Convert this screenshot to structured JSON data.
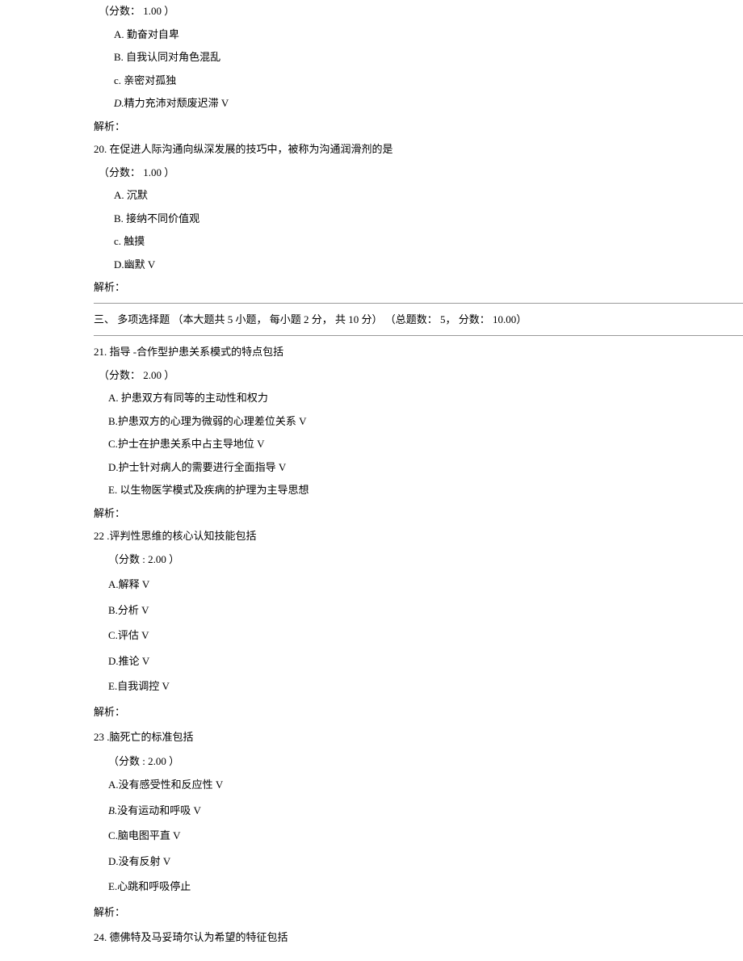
{
  "q19_tail": {
    "score": "（分数：  1.00 ）",
    "opts": {
      "a": "A.  勤奋对自卑",
      "b": "B.  自我认同对角色混乱",
      "c": "c. 亲密对孤独",
      "d_label": "D.",
      "d_text": "精力充沛对颓废迟滞 V"
    },
    "analysis": "解析："
  },
  "q20": {
    "stem": "20.  在促进人际沟通向纵深发展的技巧中，被称为沟通润滑剂的是",
    "score": "（分数：  1.00 ）",
    "opts": {
      "a": "A.  沉默",
      "b": "B.  接纳不同价值观",
      "c": "c. 触摸",
      "d": "D.幽默 V"
    },
    "analysis": "解析："
  },
  "section3": "三、 多项选择题 （本大题共 5 小题，  每小题  2 分，   共  10 分）  （总题数：  5，   分数：  10.00）",
  "q21": {
    "stem": "21.  指导  -合作型护患关系模式的特点包括",
    "score": "（分数：  2.00 ）",
    "opts": {
      "a": "A. 护患双方有同等的主动性和权力",
      "b": "B.护患双方的心理为微弱的心理差位关系  V",
      "c": "C.护士在护患关系中占主导地位  V",
      "d": "D.护士针对病人的需要进行全面指导 V",
      "e": "E. 以生物医学模式及疾病的护理为主导思想"
    },
    "analysis": "解析："
  },
  "q22": {
    "stem": "22 .评判性思维的核心认知技能包括",
    "score": "（分数 : 2.00 ）",
    "opts": {
      "a": "A.解释 V",
      "b": "B.分析 V",
      "c": "C.评估 V",
      "d": "D.推论 V",
      "e": "E.自我调控 V"
    },
    "analysis": "解析："
  },
  "q23": {
    "stem": "23 .脑死亡的标准包括",
    "score": "（分数 : 2.00 ）",
    "opts": {
      "a": "A.没有感受性和反应性 V",
      "b_label": "B.",
      "b_text": "没有运动和呼吸  V",
      "c": "C.脑电图平直  V",
      "d": "D.没有反射 V",
      "e": "E.心跳和呼吸停止"
    },
    "analysis": "解析："
  },
  "q24": {
    "stem": "24. 德佛特及马妥琦尔认为希望的特征包括"
  }
}
